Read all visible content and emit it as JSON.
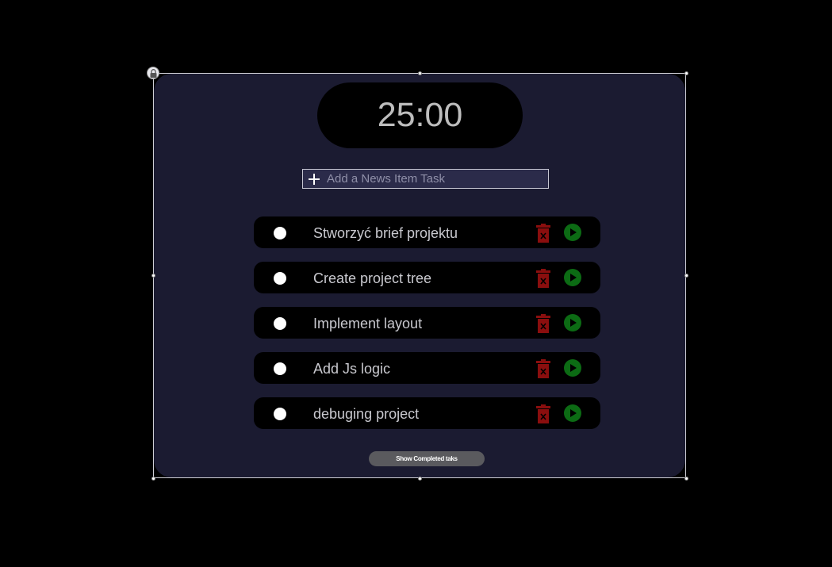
{
  "timer": {
    "display": "25:00"
  },
  "add_task": {
    "placeholder": "Add a News Item Task"
  },
  "tasks": [
    {
      "label": "Stworzyć brief projektu"
    },
    {
      "label": "Create project tree"
    },
    {
      "label": "Implement layout"
    },
    {
      "label": "Add Js logic"
    },
    {
      "label": "debuging project"
    }
  ],
  "footer": {
    "show_completed_label": "Show Completed taks"
  },
  "icons": {
    "add": "plus-icon",
    "delete": "trash-icon",
    "start": "play-icon",
    "lock": "lock-icon",
    "complete": "radio-icon"
  },
  "colors": {
    "page_background": "#000000",
    "panel_background": "#1b1b31",
    "task_background": "#000000",
    "trash": "#8a0e0e",
    "play": "#0c6b14",
    "button": "#5a5a5e",
    "timer_text": "#bdbdbd"
  }
}
